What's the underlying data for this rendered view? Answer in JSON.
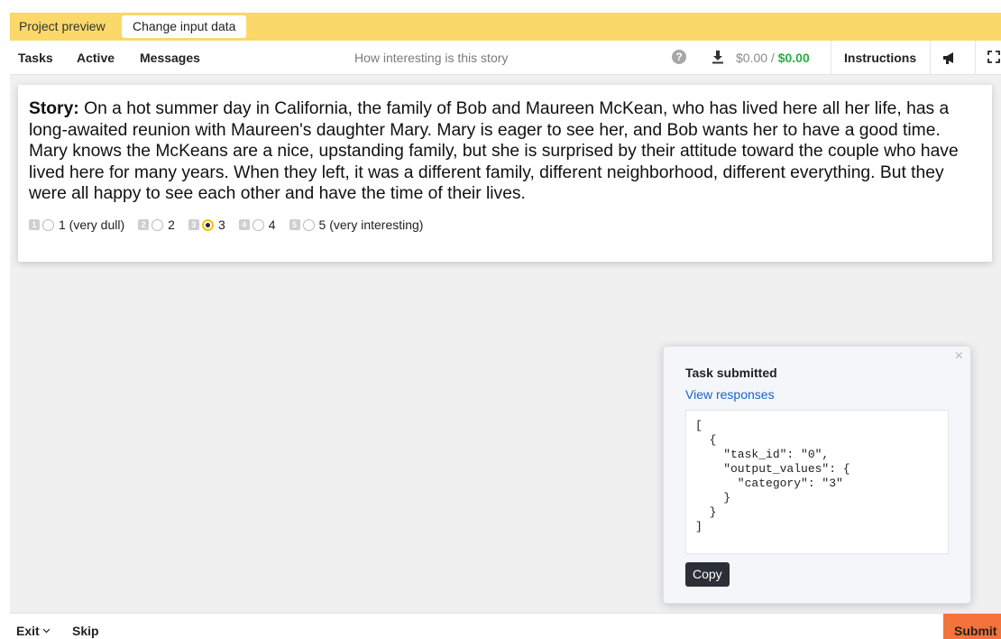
{
  "preview_bar": {
    "label": "Project preview",
    "change_input_label": "Change input data",
    "bg_color": "#fad96a"
  },
  "nav": {
    "tasks": "Tasks",
    "active": "Active",
    "messages": "Messages",
    "task_title": "How interesting is this story",
    "help_icon": "?",
    "balance_gray": "$0.00 /",
    "balance_green": "$0.00",
    "instructions": "Instructions",
    "icons": [
      "question-icon",
      "download-icon",
      "megaphone-icon",
      "fullscreen-icon"
    ]
  },
  "story": {
    "label": "Story:",
    "text": " On a hot summer day in California, the family of Bob and Maureen McKean, who has lived here all her life, has a long-awaited reunion with Maureen's daughter Mary. Mary is eager to see her, and Bob wants her to have a good time. Mary knows the McKeans are a nice, upstanding family, but she is surprised by their attitude toward the couple who have lived here for many years. When they left, it was a different family, different neighborhood, different everything. But they were all happy to see each other and have the time of their lives."
  },
  "rating": {
    "options": [
      {
        "hotkey": "1",
        "label": "1 (very dull)"
      },
      {
        "hotkey": "2",
        "label": "2"
      },
      {
        "hotkey": "3",
        "label": "3"
      },
      {
        "hotkey": "4",
        "label": "4"
      },
      {
        "hotkey": "5",
        "label": "5 (very interesting)"
      }
    ],
    "selected": "3"
  },
  "popup": {
    "close": "×",
    "title": "Task submitted",
    "link": "View responses",
    "json": "[\n  {\n    \"task_id\": \"0\",\n    \"output_values\": {\n      \"category\": \"3\"\n    }\n  }\n]",
    "copy": "Copy"
  },
  "bottom": {
    "exit": "Exit",
    "skip": "Skip",
    "submit": "Submit",
    "submit_color": "#f4723b"
  }
}
